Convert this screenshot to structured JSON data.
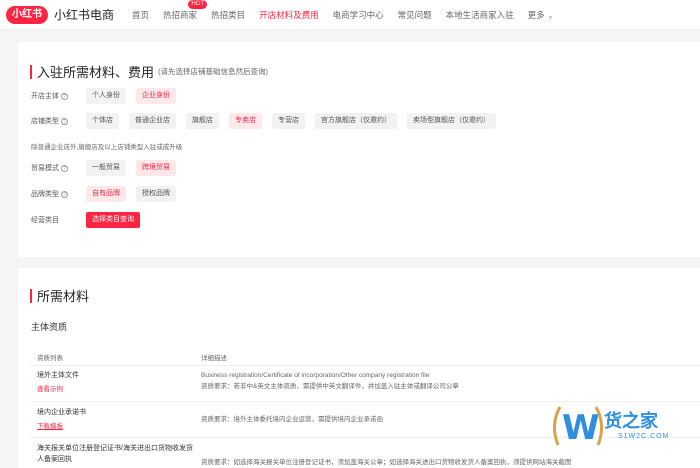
{
  "header": {
    "logo_badge": "小红书",
    "logo_text": "小红书电商",
    "nav": [
      {
        "label": "首页"
      },
      {
        "label": "热招商家",
        "badge": "HOT"
      },
      {
        "label": "热招类目"
      },
      {
        "label": "开店材料及费用",
        "active": true
      },
      {
        "label": "电商学习中心"
      },
      {
        "label": "常见问题"
      },
      {
        "label": "本地生活商家入驻"
      },
      {
        "label": "更多"
      }
    ]
  },
  "section1": {
    "title": "入驻所需材料、费用",
    "note": "(请先选择店铺基础信息然后查询)",
    "rows": {
      "subject": {
        "label": "开店主体",
        "options": [
          "个人身份",
          "企业身份"
        ],
        "selected": 1
      },
      "store_type": {
        "label": "店铺类型",
        "options": [
          "个体店",
          "普通企业店",
          "旗舰店",
          "专卖店",
          "专营店",
          "官方旗舰店（仅邀约）",
          "卖场型旗舰店（仅邀约）"
        ],
        "selected": 3
      },
      "store_tip": "除普通企业店外,旗舰店及以上店铺类型入驻或成升级",
      "trade_mode": {
        "label": "贸易模式",
        "options": [
          "一般贸易",
          "跨境贸易"
        ],
        "selected": 1
      },
      "brand_type": {
        "label": "品牌类型",
        "options": [
          "自有品牌",
          "授权品牌"
        ],
        "selected": 0
      },
      "category": {
        "label": "经营类目",
        "button": "选择类目查询"
      }
    }
  },
  "section2": {
    "title": "所需材料",
    "subtitle": "主体资质",
    "columns": [
      "资质列表",
      "详细描述"
    ],
    "rows": [
      {
        "name": "境外主体文件",
        "link": "查看示例",
        "desc": [
          "Business registration/Certificate of incorporation/Other company registration file",
          "资质要求：若非中&英文主体资质，需提供中英文翻译件，并加盖入驻主体或翻译公司公章"
        ]
      },
      {
        "name": "境内企业承诺书",
        "link": "下载模板",
        "desc": [
          "资质要求：境外主体委托境内企业运营，需提供境内企业承诺函"
        ]
      },
      {
        "name": "海关报关单位注册登记证书/海关进出口货物收发货人备案回执",
        "link": "",
        "desc": [
          "资质要求：如选择海关报关单位注册登记证书，须加盖海关公章；如选择海关进出口货物收发货人备案回执，须提供网站海关截图"
        ]
      }
    ]
  },
  "watermark": {
    "text": "货之家",
    "sub": "S1W2C.COM"
  },
  "colors": {
    "accent": "#ff2442",
    "watermark": "#2e8fe0"
  }
}
